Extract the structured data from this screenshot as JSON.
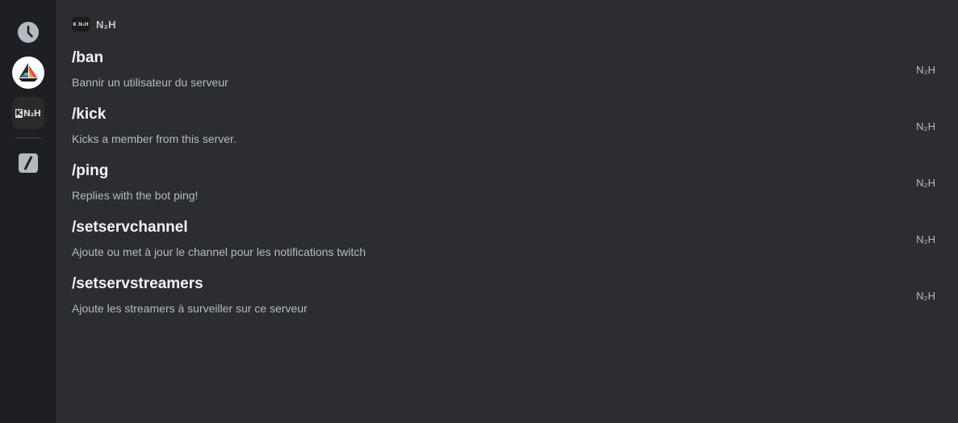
{
  "rail": {
    "items": [
      {
        "name": "recent-icon"
      },
      {
        "name": "midjourney-app"
      },
      {
        "name": "n2h-app",
        "label": "N₂H"
      },
      {
        "name": "slash-commands-icon"
      }
    ]
  },
  "section": {
    "title": "N₂H"
  },
  "commands": [
    {
      "name": "/ban",
      "description": "Bannir un utilisateur du serveur",
      "source": "N₂H"
    },
    {
      "name": "/kick",
      "description": "Kicks a member from this server.",
      "source": "N₂H"
    },
    {
      "name": "/ping",
      "description": "Replies with the bot ping!",
      "source": "N₂H"
    },
    {
      "name": "/setservchannel",
      "description": "Ajoute ou met à jour le channel pour les notifications twitch",
      "source": "N₂H"
    },
    {
      "name": "/setservstreamers",
      "description": "Ajoute les streamers à surveiller sur ce serveur",
      "source": "N₂H"
    }
  ],
  "colors": {
    "rail_bg": "#1e1f22",
    "main_bg": "#2b2d31",
    "text_primary": "#f2f3f5",
    "text_secondary": "#b5bac1"
  }
}
